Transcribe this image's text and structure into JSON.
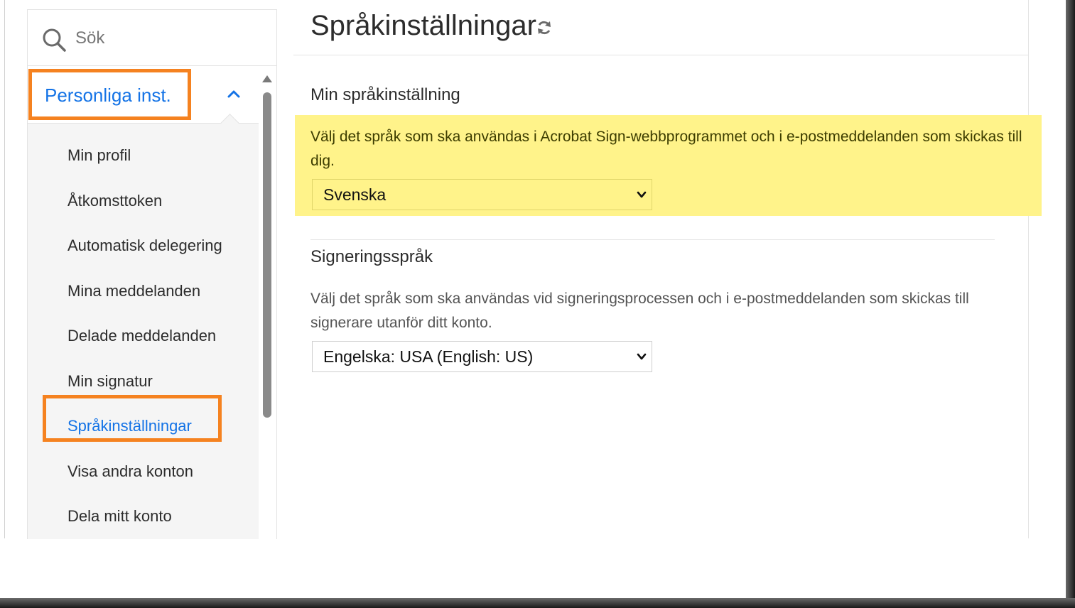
{
  "search": {
    "label": "Sök"
  },
  "sidebar": {
    "section_title": "Personliga inst.",
    "items": [
      {
        "label": "Min profil"
      },
      {
        "label": "Åtkomsttoken"
      },
      {
        "label": "Automatisk delegering"
      },
      {
        "label": "Mina meddelanden"
      },
      {
        "label": "Delade meddelanden"
      },
      {
        "label": "Min signatur"
      },
      {
        "label": "Språkinställningar",
        "active": true
      },
      {
        "label": "Visa andra konton"
      },
      {
        "label": "Dela mitt konto"
      }
    ]
  },
  "main": {
    "title": "Språkinställningar",
    "my_language": {
      "heading": "Min språkinställning",
      "description": "Välj det språk som ska användas i Acrobat Sign-webbprogrammet och i e-postmeddelanden som skickas till dig.",
      "selected": "Svenska"
    },
    "signing_language": {
      "heading": "Signeringsspråk",
      "description": "Välj det språk som ska användas vid signeringsprocessen och i e-postmeddelanden som skickas till signerare utanför ditt konto.",
      "selected": "Engelska: USA (English: US)"
    }
  },
  "colors": {
    "accent": "#1473e6",
    "highlight": "#fff38a",
    "callout": "#f58220"
  }
}
